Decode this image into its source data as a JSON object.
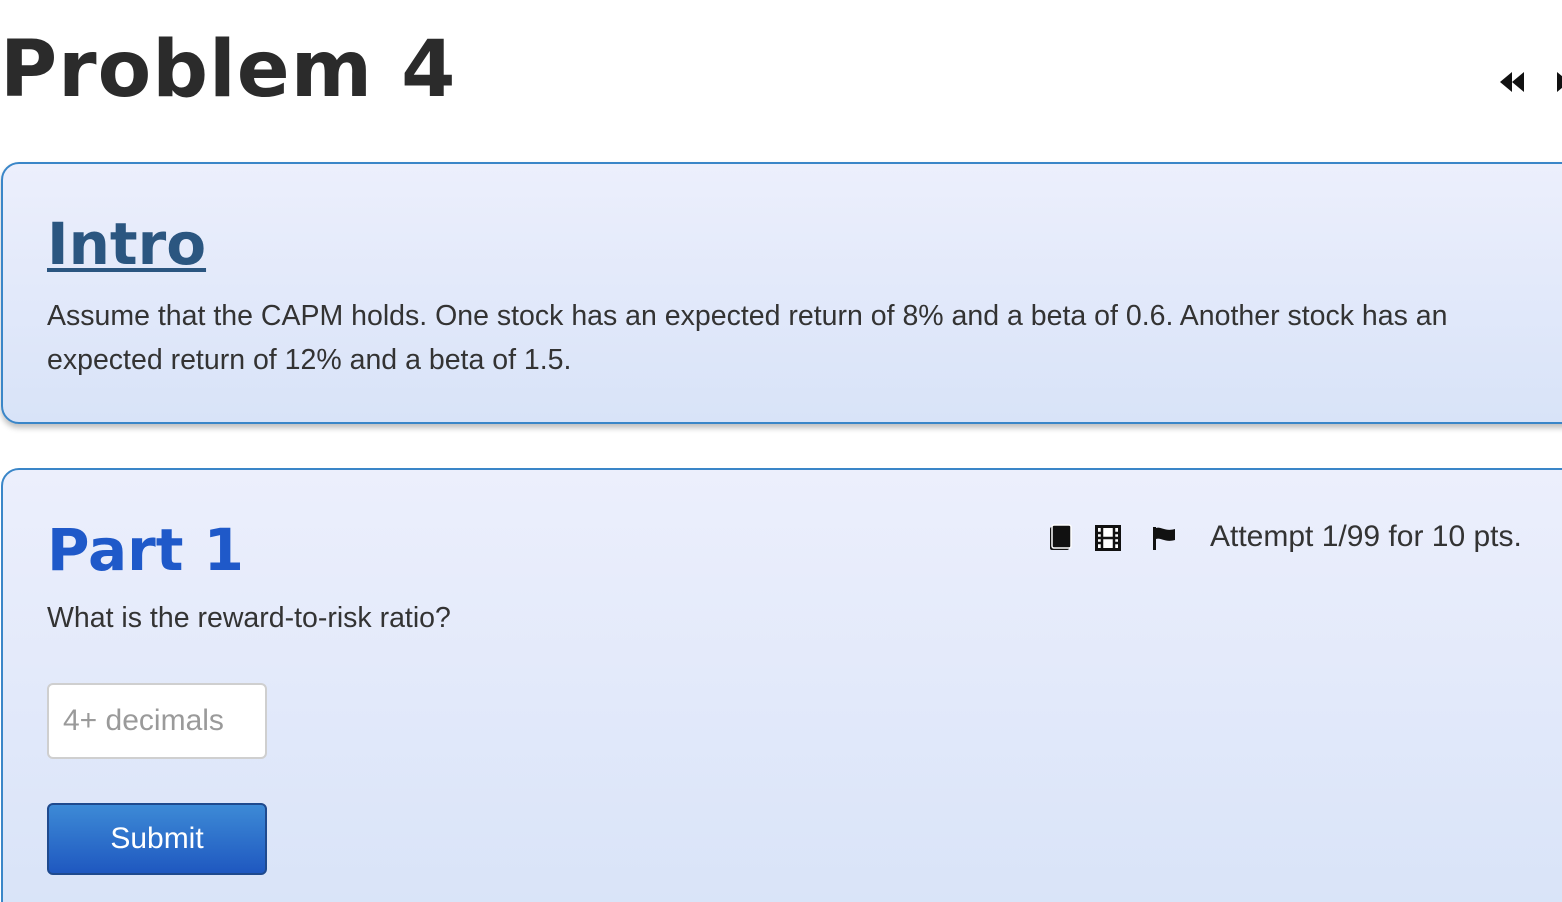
{
  "problem": {
    "title": "Problem 4"
  },
  "nav": {
    "prev_icon": "double-chevron-left-icon",
    "next_icon": "chevron-right-icon"
  },
  "intro": {
    "heading": "Intro",
    "text": "Assume that the CAPM holds. One stock has an expected return of 8% and a beta of 0.6. Another stock has an expected return of 12% and a beta of 1.5."
  },
  "part": {
    "heading": "Part 1",
    "icons": [
      "book-icon",
      "film-icon",
      "flag-icon"
    ],
    "attempt_text": "Attempt 1/99 for 10 pts.",
    "question": "What is the reward-to-risk ratio?",
    "input": {
      "value": "",
      "placeholder": "4+ decimals"
    },
    "submit_label": "Submit"
  },
  "colors": {
    "card_border": "#3a86c8",
    "intro_heading": "#2b5680",
    "part_heading": "#1f59c9",
    "submit_bg": "#1f58c0"
  }
}
